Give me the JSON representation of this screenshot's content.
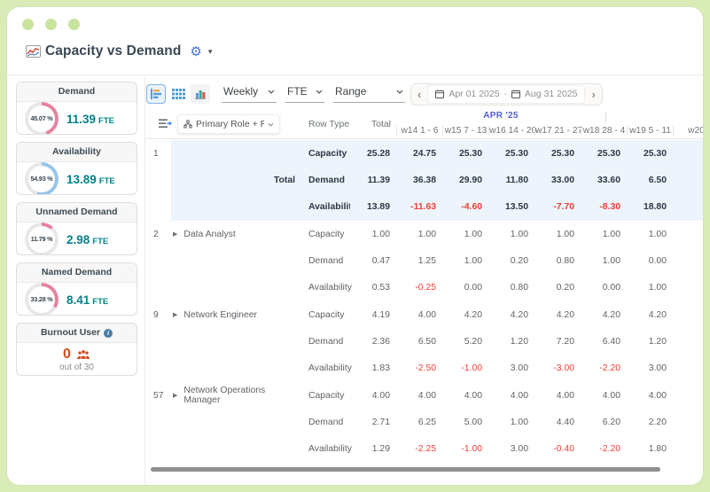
{
  "window": {
    "title": "Capacity vs Demand"
  },
  "colors": {
    "frame_green": "#d9ecb7",
    "teal_value": "#00838a",
    "demand_pink": "#e8829e",
    "availability_blue": "#95c5ec",
    "negative_red": "#ef3e36",
    "burnout_red": "#d34a1e",
    "month_label_blue": "#515fd4",
    "highlight_row_bg": "#edf4fb"
  },
  "sidebar": {
    "cards": [
      {
        "title": "Demand",
        "percent_label": "45.07 %",
        "percent": 45.07,
        "value": "11.39",
        "unit": "FTE",
        "arc_color": "#e8829e"
      },
      {
        "title": "Availability",
        "percent_label": "54.93 %",
        "percent": 54.93,
        "value": "13.89",
        "unit": "FTE",
        "arc_color": "#95c5ec"
      },
      {
        "title": "Unnamed Demand",
        "percent_label": "11.79 %",
        "percent": 11.79,
        "value": "2.98",
        "unit": "FTE",
        "arc_color": "#e8829e"
      },
      {
        "title": "Named Demand",
        "percent_label": "33.28 %",
        "percent": 33.28,
        "value": "8.41",
        "unit": "FTE",
        "arc_color": "#e8829e"
      }
    ],
    "burnout": {
      "title": "Burnout User",
      "count": "0",
      "caption": "out of 30"
    }
  },
  "toolbar": {
    "dropdowns": [
      {
        "label": "Weekly"
      },
      {
        "label": "FTE"
      },
      {
        "label": "Range"
      }
    ],
    "date_range": {
      "start": "Apr 01 2025",
      "separator": "-",
      "end": "Aug 31 2025",
      "prev": "‹",
      "next": "›"
    }
  },
  "table": {
    "grouping_label": "Primary Role + Resource...",
    "row_type_label": "Row Type",
    "total_label": "Total",
    "month_label": "APR '25",
    "week_labels": [
      "w14 1 - 6",
      "w15 7 - 13",
      "w16 14 - 20",
      "w17 21 - 27",
      "w18 28 - 4",
      "w19 5 - 11",
      "w20"
    ],
    "groups": [
      {
        "num": "1",
        "name": "Total",
        "name_row": 1,
        "name_right": true,
        "expandable": false,
        "highlight": true,
        "rows": [
          {
            "type": "Capacity",
            "values": [
              "25.28",
              "24.75",
              "25.30",
              "25.30",
              "25.30",
              "25.30",
              "25.30"
            ]
          },
          {
            "type": "Demand",
            "values": [
              "11.39",
              "36.38",
              "29.90",
              "11.80",
              "33.00",
              "33.60",
              "6.50"
            ]
          },
          {
            "type": "Availability",
            "values": [
              "13.89",
              "-11.63",
              "-4.60",
              "13.50",
              "-7.70",
              "-8.30",
              "18.80"
            ]
          }
        ]
      },
      {
        "num": "2",
        "name": "Data Analyst",
        "name_row": 0,
        "name_right": false,
        "expandable": true,
        "highlight": false,
        "rows": [
          {
            "type": "Capacity",
            "values": [
              "1.00",
              "1.00",
              "1.00",
              "1.00",
              "1.00",
              "1.00",
              "1.00"
            ]
          },
          {
            "type": "Demand",
            "values": [
              "0.47",
              "1.25",
              "1.00",
              "0.20",
              "0.80",
              "1.00",
              "0.00"
            ]
          },
          {
            "type": "Availability",
            "values": [
              "0.53",
              "-0.25",
              "0.00",
              "0.80",
              "0.20",
              "0.00",
              "1.00"
            ]
          }
        ]
      },
      {
        "num": "9",
        "name": "Network Engineer",
        "name_row": 0,
        "name_right": false,
        "expandable": true,
        "highlight": false,
        "rows": [
          {
            "type": "Capacity",
            "values": [
              "4.19",
              "4.00",
              "4.20",
              "4.20",
              "4.20",
              "4.20",
              "4.20"
            ]
          },
          {
            "type": "Demand",
            "values": [
              "2.36",
              "6.50",
              "5.20",
              "1.20",
              "7.20",
              "6.40",
              "1.20"
            ]
          },
          {
            "type": "Availability",
            "values": [
              "1.83",
              "-2.50",
              "-1.00",
              "3.00",
              "-3.00",
              "-2.20",
              "3.00"
            ]
          }
        ]
      },
      {
        "num": "57",
        "name": "Network Operations Manager",
        "name_row": 0,
        "name_right": false,
        "expandable": true,
        "highlight": false,
        "rows": [
          {
            "type": "Capacity",
            "values": [
              "4.00",
              "4.00",
              "4.00",
              "4.00",
              "4.00",
              "4.00",
              "4.00"
            ]
          },
          {
            "type": "Demand",
            "values": [
              "2.71",
              "6.25",
              "5.00",
              "1.00",
              "4.40",
              "6.20",
              "2.20"
            ]
          },
          {
            "type": "Availability",
            "values": [
              "1.29",
              "-2.25",
              "-1.00",
              "3.00",
              "-0.40",
              "-2.20",
              "1.80"
            ]
          }
        ]
      }
    ]
  }
}
